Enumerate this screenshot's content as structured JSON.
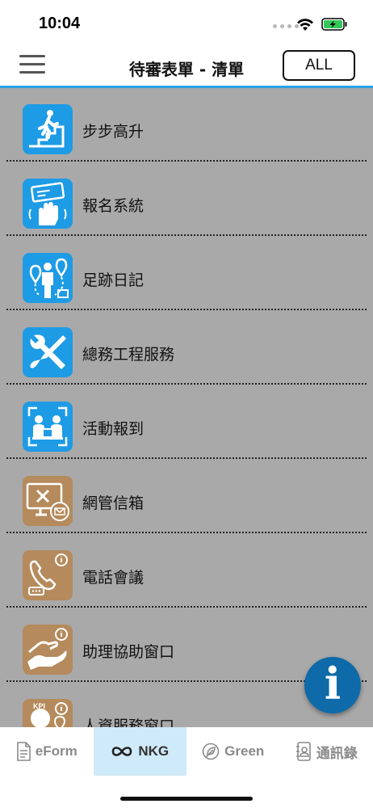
{
  "status_bar": {
    "time": "10:04"
  },
  "header": {
    "title": "待審表單 - 清單",
    "all_button_label": "ALL"
  },
  "list": {
    "items": [
      {
        "label": "步步高升",
        "icon": "stairs-climbing-icon",
        "icon_color": "#1e9be5"
      },
      {
        "label": "報名系統",
        "icon": "registration-ticket-icon",
        "icon_color": "#1e9be5"
      },
      {
        "label": "足跡日記",
        "icon": "footprint-route-icon",
        "icon_color": "#1e9be5"
      },
      {
        "label": "總務工程服務",
        "icon": "wrench-screwdriver-icon",
        "icon_color": "#1e9be5"
      },
      {
        "label": "活動報到",
        "icon": "event-checkin-icon",
        "icon_color": "#1e9be5"
      },
      {
        "label": "網管信箱",
        "icon": "network-mail-icon",
        "icon_color": "#b58a5c"
      },
      {
        "label": "電話會議",
        "icon": "phone-meeting-icon",
        "icon_color": "#b58a5c"
      },
      {
        "label": "助理協助窗口",
        "icon": "helping-hand-icon",
        "icon_color": "#b58a5c"
      },
      {
        "label": "人資服務窗口",
        "icon": "hr-kpi-icon",
        "icon_color": "#b58a5c"
      }
    ]
  },
  "info_button": {
    "glyph": "i"
  },
  "tab_bar": {
    "tabs": [
      {
        "label": "eForm",
        "icon": "document-icon",
        "active": false
      },
      {
        "label": "NKG",
        "icon": "infinity-icon",
        "active": true
      },
      {
        "label": "Green",
        "icon": "leaf-icon",
        "active": false
      },
      {
        "label": "通訊錄",
        "icon": "contacts-book-icon",
        "active": false
      }
    ]
  },
  "colors": {
    "accent_blue": "#2aa2e3",
    "icon_blue": "#1e9be5",
    "icon_brown": "#b58a5c",
    "list_background": "#a9a9a9",
    "fab_blue": "#0e6aa8",
    "active_tab_background": "#cfeaf8"
  }
}
